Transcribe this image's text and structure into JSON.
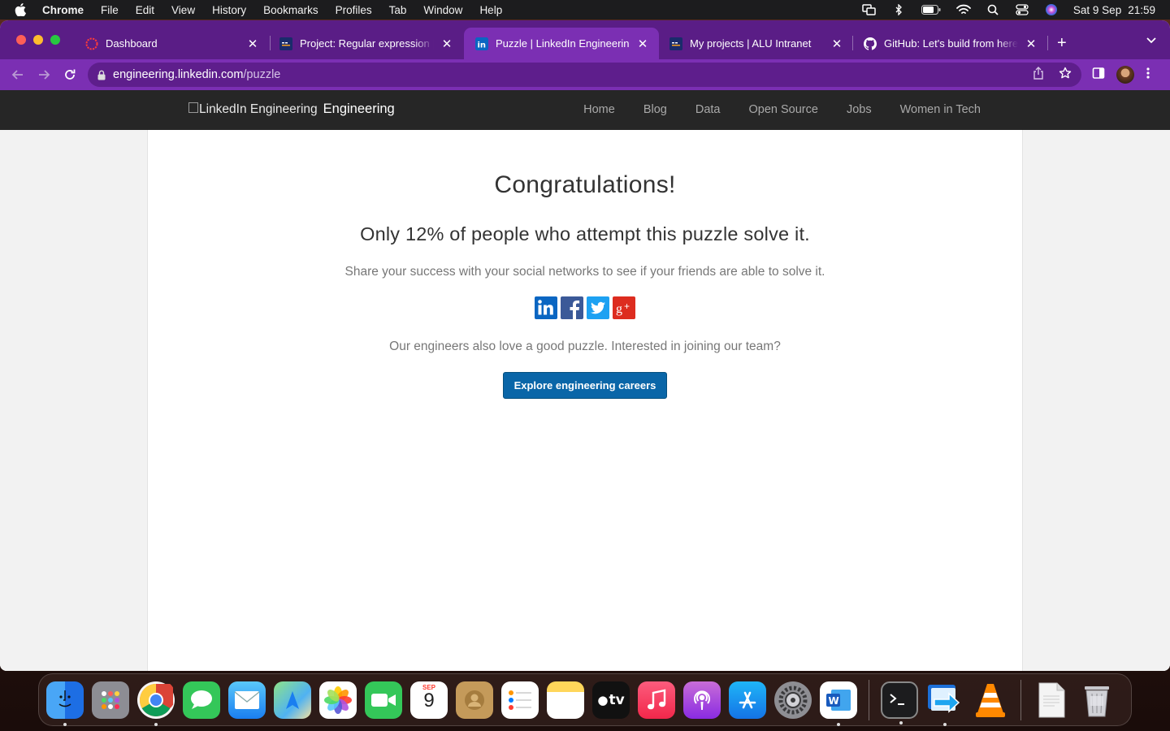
{
  "menubar": {
    "app_name": "Chrome",
    "items": [
      "File",
      "Edit",
      "View",
      "History",
      "Bookmarks",
      "Profiles",
      "Tab",
      "Window",
      "Help"
    ],
    "date": "Sat 9 Sep",
    "time": "21:59"
  },
  "browser": {
    "tabs": [
      {
        "title": "Dashboard",
        "favicon": "dashboard-icon"
      },
      {
        "title": "Project: Regular expression | ALU Intranet",
        "favicon": "alu-icon"
      },
      {
        "title": "Puzzle | LinkedIn Engineering",
        "favicon": "linkedin-icon",
        "active": true
      },
      {
        "title": "My projects | ALU Intranet",
        "favicon": "alu-icon"
      },
      {
        "title": "GitHub: Let's build from here · GitHub",
        "favicon": "github-icon"
      }
    ],
    "url_host": "engineering.linkedin.com",
    "url_path": "/puzzle"
  },
  "site": {
    "logo_alt": "LinkedIn Engineering",
    "logo_word": "Engineering",
    "nav": [
      "Home",
      "Blog",
      "Data",
      "Open Source",
      "Jobs",
      "Women in Tech"
    ]
  },
  "puzzle": {
    "heading": "Congratulations!",
    "stat": "Only 12% of people who attempt this puzzle solve it.",
    "share_text": "Share your success with your social networks to see if your friends are able to solve it.",
    "social": [
      "linkedin",
      "facebook",
      "twitter",
      "google-plus"
    ],
    "join_text": "Our engineers also love a good puzzle. Interested in joining our team?",
    "cta_label": "Explore engineering careers"
  },
  "dock": {
    "calendar_month": "SEP",
    "calendar_day": "9",
    "tv_label": "tv"
  },
  "colors": {
    "tabstrip": "#5a1d86",
    "toolbar": "#7b2fb3",
    "cta": "#0a66a8",
    "site_header": "#262626"
  }
}
